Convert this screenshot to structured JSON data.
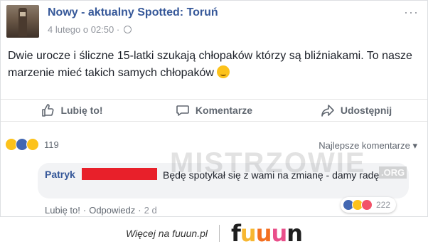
{
  "post": {
    "page_name": "Nowy - aktualny Spotted: Toruń",
    "timestamp": "4 lutego o 02:50 ·",
    "text": "Dwie urocze i śliczne 15-latki szukają chłopaków którzy są bliźniakami. To nasze marzenie mieć takich samych chłopaków",
    "icons": {
      "avatar": "tower-photo",
      "privacy": "globe-icon",
      "more": "more-icon",
      "emoji": "smirk-emoji"
    }
  },
  "actions": [
    {
      "label": "Lubię to!",
      "icon": "like-icon"
    },
    {
      "label": "Komentarze",
      "icon": "comment-icon"
    },
    {
      "label": "Udostępnij",
      "icon": "share-icon"
    }
  ],
  "reactions": {
    "types": [
      "haha",
      "like",
      "sad"
    ],
    "count": "119"
  },
  "sort_label": "Najlepsze komentarze ▾",
  "comment": {
    "author": "Patryk",
    "text": "Będę spotykał się z wami na zmianę - damy radę",
    "like_label": "Lubię to!",
    "reply_label": "Odpowiedz",
    "age": "2 d",
    "reactions": [
      "like",
      "haha",
      "love"
    ],
    "reaction_count": "222"
  },
  "watermark": {
    "main": "MISTRZOWIE",
    "org": ".ORG"
  },
  "footer": {
    "text": "Więcej na fuuun.pl",
    "logo": [
      "f",
      "u",
      "u",
      "u",
      "n"
    ]
  },
  "colors": {
    "link": "#365899",
    "redaction": "#e8202a",
    "like": "#4267b2"
  }
}
